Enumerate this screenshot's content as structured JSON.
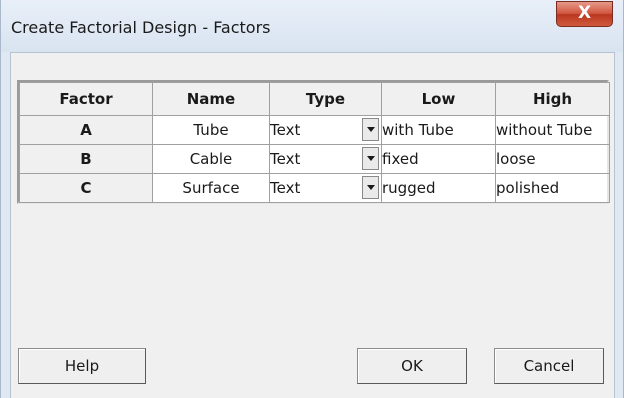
{
  "window": {
    "title": "Create Factorial Design - Factors",
    "close_label": "X"
  },
  "table": {
    "headers": [
      "Factor",
      "Name",
      "Type",
      "Low",
      "High"
    ],
    "rows": [
      {
        "factor": "A",
        "name": "Tube",
        "type": "Text",
        "low": "with Tube",
        "high": "without Tube"
      },
      {
        "factor": "B",
        "name": "Cable",
        "type": "Text",
        "low": "fixed",
        "high": "loose"
      },
      {
        "factor": "C",
        "name": "Surface",
        "type": "Text",
        "low": "rugged",
        "high": "polished"
      }
    ]
  },
  "buttons": {
    "help": "Help",
    "ok": "OK",
    "cancel": "Cancel"
  },
  "colors": {
    "close_button": "#c9452d",
    "frame": "#dfe8f3"
  }
}
